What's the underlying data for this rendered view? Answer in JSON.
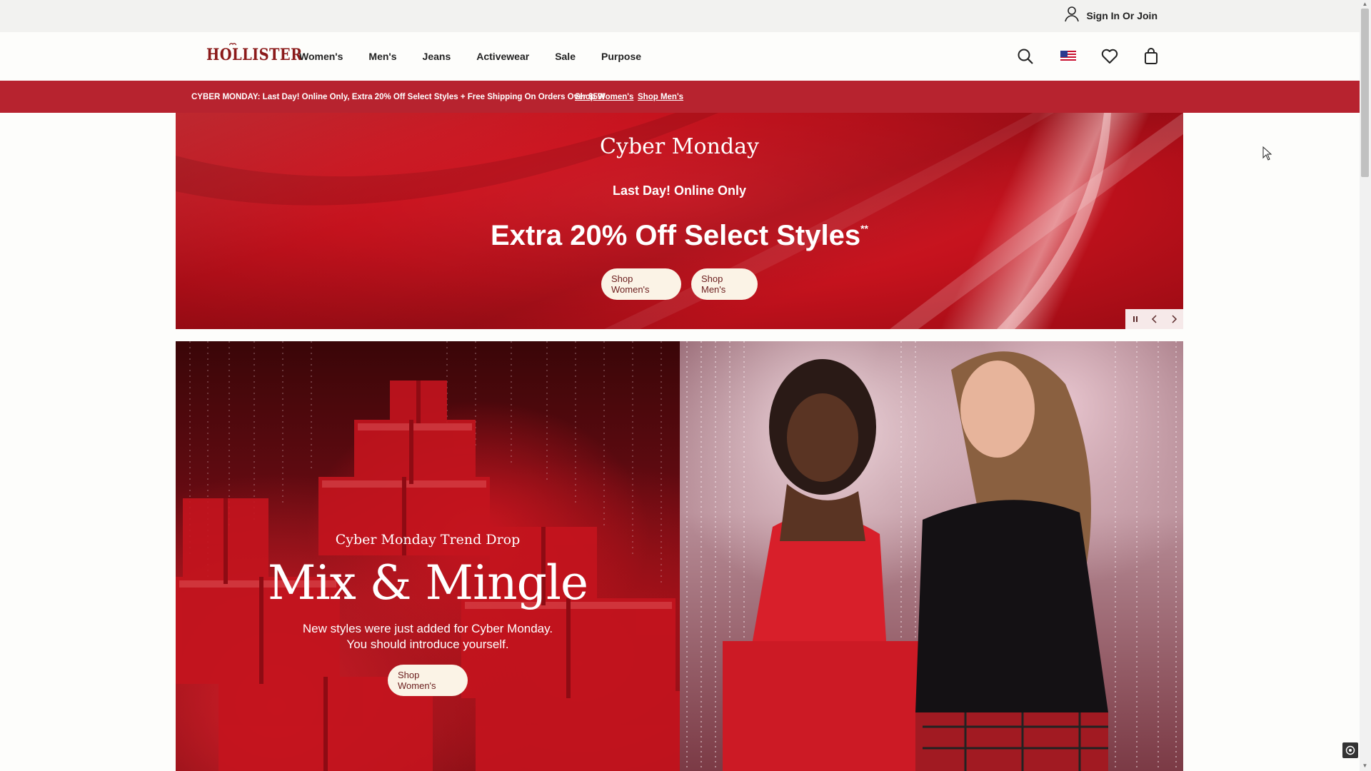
{
  "utility": {
    "signin_label": "Sign In Or Join"
  },
  "header": {
    "logo": "HOLLISTER",
    "nav": [
      "Women's",
      "Men's",
      "Jeans",
      "Activewear",
      "Sale",
      "Purpose"
    ],
    "icons": [
      "search-icon",
      "us-flag-icon",
      "heart-icon",
      "bag-icon"
    ]
  },
  "promo": {
    "text": "CYBER MONDAY: Last Day! Online Only, Extra 20% Off Select Styles + Free Shipping On Orders Over $59!",
    "link_women": "Shop Women's",
    "link_men": "Shop Men's"
  },
  "hero": {
    "title": "Cyber Monday",
    "subtitle": "Last Day! Online Only",
    "offer": "Extra 20% Off Select Styles",
    "offer_mark": "**",
    "btn_women": "Shop Women's",
    "btn_men": "Shop Men's"
  },
  "mix": {
    "kicker": "Cyber Monday Trend Drop",
    "title": "Mix & Mingle",
    "body_line1": "New styles were just added for Cyber Monday.",
    "body_line2": "You should introduce yourself.",
    "btn": "Shop Women's"
  },
  "colors": {
    "brand_red": "#b7232f",
    "logo_red": "#8b1a1a",
    "pill_bg": "#fbf3e6"
  }
}
